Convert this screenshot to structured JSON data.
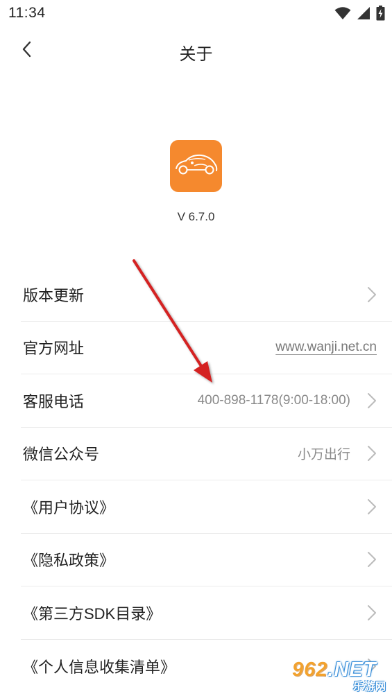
{
  "status_bar": {
    "time": "11:34",
    "icons": [
      "wifi-icon",
      "signal-icon",
      "battery-icon"
    ]
  },
  "nav": {
    "back_icon": "chevron-left-icon",
    "title": "关于"
  },
  "app": {
    "logo_icon": "car-logo-icon",
    "logo_color": "#f5892e",
    "version": "V 6.7.0"
  },
  "settings": {
    "items": [
      {
        "label": "版本更新",
        "value": "",
        "chevron": true
      },
      {
        "label": "官方网址",
        "value": "www.wanji.net.cn",
        "chevron": false
      },
      {
        "label": "客服电话",
        "value": "400-898-1178(9:00-18:00)",
        "chevron": true
      },
      {
        "label": "微信公众号",
        "value": "小万出行",
        "chevron": true
      },
      {
        "label": "《用户协议》",
        "value": "",
        "chevron": true
      },
      {
        "label": "《隐私政策》",
        "value": "",
        "chevron": true
      },
      {
        "label": "《第三方SDK目录》",
        "value": "",
        "chevron": true
      },
      {
        "label": "《个人信息收集清单》",
        "value": "",
        "chevron": true
      }
    ]
  },
  "annotation": {
    "arrow_color": "#d42020"
  },
  "watermark": {
    "main_prefix": "962",
    "main_suffix": ".NET",
    "sub": "乐游网"
  }
}
